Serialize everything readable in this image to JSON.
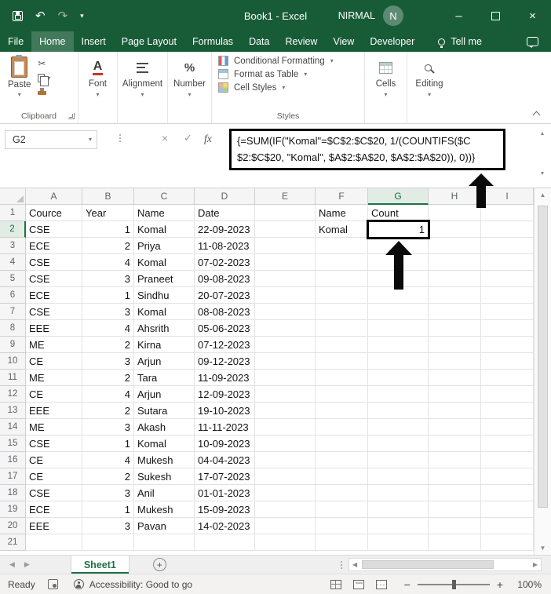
{
  "window": {
    "title": "Book1 - Excel",
    "user_name": "NIRMAL",
    "user_initial": "N"
  },
  "menu": {
    "tabs": [
      "File",
      "Home",
      "Insert",
      "Page Layout",
      "Formulas",
      "Data",
      "Review",
      "View",
      "Developer"
    ],
    "active_tab": "Home",
    "tell_me": "Tell me"
  },
  "ribbon": {
    "paste_label": "Paste",
    "clipboard_group": "Clipboard",
    "font_group": "Font",
    "alignment_group": "Alignment",
    "number_group": "Number",
    "styles_group": "Styles",
    "styles_items": [
      "Conditional Formatting",
      "Format as Table",
      "Cell Styles"
    ],
    "cells_group": "Cells",
    "editing_group": "Editing"
  },
  "formula_bar": {
    "name_box": "G2",
    "fx": "fx",
    "formula": "{=SUM(IF(\"Komal\"=$C$2:$C$20, 1/(COUNTIFS($C$2:$C$20, \"Komal\", $A$2:$A$20, $A$2:$A$20)), 0))}"
  },
  "grid": {
    "columns": [
      "A",
      "B",
      "C",
      "D",
      "E",
      "F",
      "G",
      "H",
      "I"
    ],
    "selected_cell": "G2",
    "selected_column": "G",
    "selected_row": "2",
    "rows": [
      {
        "n": "1",
        "A": "Cource",
        "B": "Year",
        "C": "Name",
        "D": "Date",
        "F": "Name",
        "G": "Count"
      },
      {
        "n": "2",
        "A": "CSE",
        "B": "1",
        "C": "Komal",
        "D": "22-09-2023",
        "F": "Komal",
        "G": "1"
      },
      {
        "n": "3",
        "A": "ECE",
        "B": "2",
        "C": "Priya",
        "D": "11-08-2023"
      },
      {
        "n": "4",
        "A": "CSE",
        "B": "4",
        "C": "Komal",
        "D": "07-02-2023"
      },
      {
        "n": "5",
        "A": "CSE",
        "B": "3",
        "C": "Praneet",
        "D": "09-08-2023"
      },
      {
        "n": "6",
        "A": "ECE",
        "B": "1",
        "C": "Sindhu",
        "D": "20-07-2023"
      },
      {
        "n": "7",
        "A": "CSE",
        "B": "3",
        "C": "Komal",
        "D": "08-08-2023"
      },
      {
        "n": "8",
        "A": "EEE",
        "B": "4",
        "C": "Ahsrith",
        "D": "05-06-2023"
      },
      {
        "n": "9",
        "A": "ME",
        "B": "2",
        "C": "Kirna",
        "D": "07-12-2023"
      },
      {
        "n": "10",
        "A": "CE",
        "B": "3",
        "C": "Arjun",
        "D": "09-12-2023"
      },
      {
        "n": "11",
        "A": "ME",
        "B": "2",
        "C": "Tara",
        "D": "11-09-2023"
      },
      {
        "n": "12",
        "A": "CE",
        "B": "4",
        "C": "Arjun",
        "D": "12-09-2023"
      },
      {
        "n": "13",
        "A": "EEE",
        "B": "2",
        "C": "Sutara",
        "D": "19-10-2023"
      },
      {
        "n": "14",
        "A": "ME",
        "B": "3",
        "C": "Akash",
        "D": "11-11-2023"
      },
      {
        "n": "15",
        "A": "CSE",
        "B": "1",
        "C": "Komal",
        "D": "10-09-2023"
      },
      {
        "n": "16",
        "A": "CE",
        "B": "4",
        "C": "Mukesh",
        "D": "04-04-2023"
      },
      {
        "n": "17",
        "A": "CE",
        "B": "2",
        "C": "Sukesh",
        "D": "17-07-2023"
      },
      {
        "n": "18",
        "A": "CSE",
        "B": "3",
        "C": "Anil",
        "D": "01-01-2023"
      },
      {
        "n": "19",
        "A": "ECE",
        "B": "1",
        "C": "Mukesh",
        "D": "15-09-2023"
      },
      {
        "n": "20",
        "A": "EEE",
        "B": "3",
        "C": "Pavan",
        "D": "14-02-2023"
      },
      {
        "n": "21"
      }
    ]
  },
  "sheet_bar": {
    "active_sheet": "Sheet1"
  },
  "status_bar": {
    "ready": "Ready",
    "accessibility": "Accessibility: Good to go",
    "zoom_level": "100%"
  },
  "icons": {
    "caret_down": "▾",
    "scissors": "✂",
    "check": "✓",
    "cancel": "×",
    "undo": "↶",
    "redo": "↷",
    "minimize": "–",
    "close": "×",
    "plus": "+",
    "minus": "−",
    "left_triangle": "◀",
    "right_triangle": "▶",
    "up_triangle": "▲",
    "down_triangle": "▼"
  },
  "colors": {
    "title_green": "#185C37",
    "accent_green": "#217346",
    "annotation_black": "#000000"
  }
}
